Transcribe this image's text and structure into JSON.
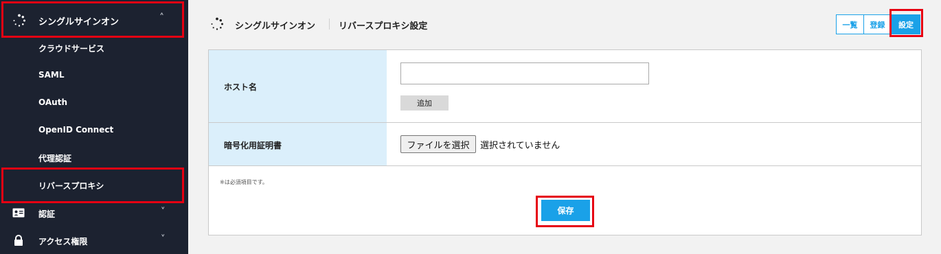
{
  "sidebar": {
    "parent": {
      "label": "シングルサインオン",
      "icon": "spinner-dots-icon",
      "chevron": "˄"
    },
    "subitems": [
      {
        "label": "クラウドサービス"
      },
      {
        "label": "SAML"
      },
      {
        "label": "OAuth"
      },
      {
        "label": "OpenID Connect"
      },
      {
        "label": "代理認証"
      },
      {
        "label": "リバースプロキシ"
      }
    ],
    "categories": [
      {
        "label": "認証",
        "icon": "id-card-icon",
        "chevron": "˅"
      },
      {
        "label": "アクセス権限",
        "icon": "lock-icon",
        "chevron": "˅"
      }
    ]
  },
  "header": {
    "title": "シングルサインオン",
    "subtitle": "リバースプロキシ設定",
    "tabs": [
      {
        "label": "一覧"
      },
      {
        "label": "登録"
      },
      {
        "label": "設定"
      }
    ]
  },
  "form": {
    "hostname_label": "ホスト名",
    "hostname_value": "",
    "add_label": "追加",
    "cert_label": "暗号化用証明書",
    "file_button_label": "ファイルを選択",
    "file_status": "選択されていません",
    "required_note": "※は必須項目です。",
    "save_label": "保存"
  },
  "colors": {
    "sidebar_bg": "#1c2230",
    "accent": "#1aa1e8",
    "highlight": "#e60012",
    "label_cell_bg": "#dbeffb"
  }
}
